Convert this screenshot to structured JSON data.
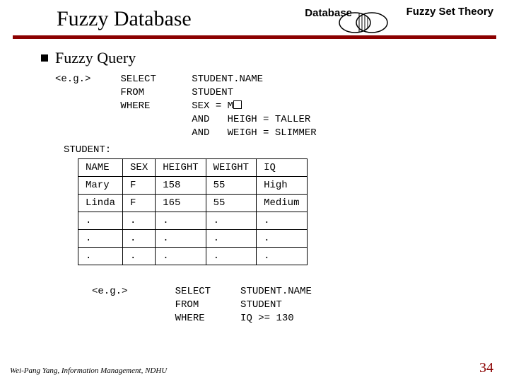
{
  "header": {
    "title": "Fuzzy Database",
    "label_left": "Database",
    "label_right": "Fuzzy Set Theory"
  },
  "bullet": {
    "text": "Fuzzy Query"
  },
  "query1": {
    "eg": "<e.g.>",
    "l1": "SELECT      STUDENT.NAME",
    "l2": "FROM        STUDENT",
    "l3_pre": "WHERE       SEX = M",
    "l4": "            AND   HEIGH = TALLER",
    "l5": "            AND   WEIGH = SLIMMER"
  },
  "table": {
    "label": "STUDENT:",
    "headers": {
      "c0": "NAME",
      "c1": "SEX",
      "c2": "HEIGHT",
      "c3": "WEIGHT",
      "c4": "IQ"
    },
    "r0": {
      "c0": "Mary",
      "c1": "F",
      "c2": "158",
      "c3": "55",
      "c4": "High"
    },
    "r1": {
      "c0": "Linda",
      "c1": "F",
      "c2": "165",
      "c3": "55",
      "c4": "Medium"
    },
    "r2": {
      "c0": ".",
      "c1": ".",
      "c2": ".",
      "c3": ".",
      "c4": "."
    },
    "r3": {
      "c0": ".",
      "c1": ".",
      "c2": ".",
      "c3": ".",
      "c4": "."
    },
    "r4": {
      "c0": ".",
      "c1": ".",
      "c2": ".",
      "c3": ".",
      "c4": "."
    }
  },
  "query2": {
    "eg": "<e.g.>",
    "l1": "SELECT     STUDENT.NAME",
    "l2": "FROM       STUDENT",
    "l3": "WHERE      IQ >= 130"
  },
  "footer": {
    "left": "Wei-Pang Yang, Information Management, NDHU",
    "page": "34"
  }
}
